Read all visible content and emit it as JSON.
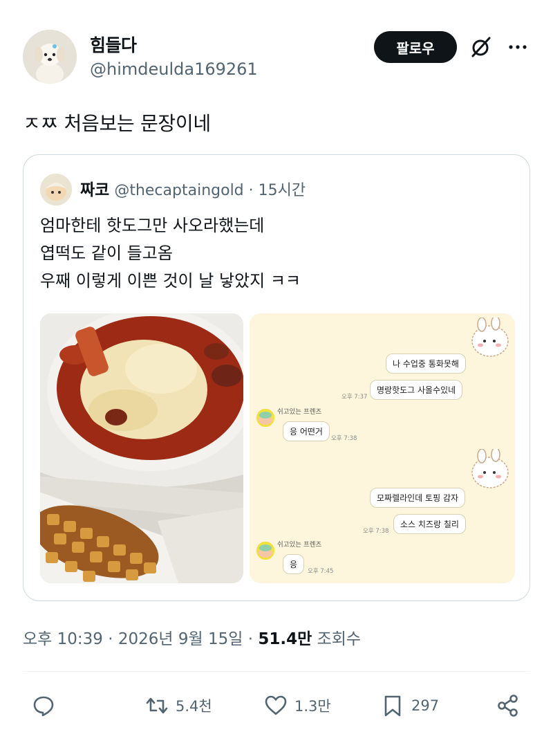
{
  "author": {
    "display_name": "힘들다",
    "handle": "@himdeulda169261"
  },
  "follow_label": "팔로우",
  "icons": {
    "grok": "grok-icon",
    "more": "more-horizontal-icon",
    "reply": "reply-icon",
    "retweet": "retweet-icon",
    "like": "heart-icon",
    "bookmark": "bookmark-icon",
    "share": "share-icon"
  },
  "tweet_text": "ㅈㅉ 처음보는 문장이네",
  "quote": {
    "display_name": "짜코",
    "handle": "@thecaptaingold",
    "separator": "·",
    "time": "15시간",
    "lines": [
      "엄마한테 핫도그만 사오라했는데",
      "엽떡도 같이 들고옴",
      "우째 이렇게 이쁜 것이 날 낳았지 ㅋㅋ"
    ]
  },
  "chat": {
    "messages": [
      {
        "side": "me",
        "text": "나 수업중 통화못해",
        "time": ""
      },
      {
        "side": "me",
        "text": "명랑핫도그 사올수있네",
        "time": "오후 7:37"
      },
      {
        "side": "friend",
        "sender": "쉬고있는 프렌즈",
        "text": "응 어떤거",
        "time": "오후 7:38"
      },
      {
        "side": "me",
        "text": "모짜렐라인데 토핑 감자",
        "time": ""
      },
      {
        "side": "me",
        "text": "소스 치즈랑 칠리",
        "time": "오후 7:38"
      },
      {
        "side": "friend",
        "sender": "쉬고있는 프렌즈",
        "text": "응",
        "time": "오후 7:45"
      }
    ]
  },
  "meta": {
    "time": "오후 10:39",
    "sep1": "·",
    "date": "2026년 9월 15일",
    "sep2": "·",
    "views": "51.4만",
    "views_label": "조회수"
  },
  "actions": {
    "reply_count": "",
    "retweet_count": "5.4천",
    "like_count": "1.3만",
    "bookmark_count": "297"
  },
  "colors": {
    "text_primary": "#0f1419",
    "text_secondary": "#536471",
    "border": "#cfd9de",
    "follow_bg": "#0f1419",
    "chat_bg": "#fdf6dc"
  }
}
